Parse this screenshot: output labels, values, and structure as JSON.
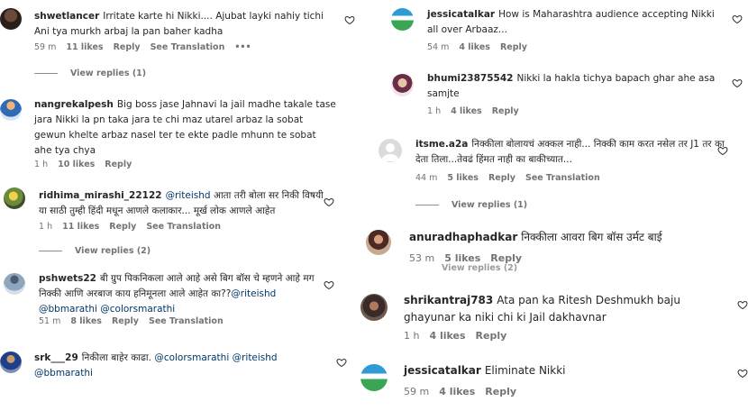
{
  "left": {
    "comments": [
      {
        "user": "shwetlancer",
        "text": "Irritate karte hi Nikki.... Ajubat layki nahiy tichi Ani tya murkh arbaj la pan baher kadha",
        "time": "59 m",
        "likes": "11 likes",
        "reply": "Reply",
        "extra": "See Translation",
        "more": "•••"
      },
      {
        "user": "nangrekalpesh",
        "text": "Big boss jase Jahnavi la jail madhe takale tase jara Nikki la pn taka jara te chi maz utarel arbaz la sobat gewun khelte arbaz nasel ter te ekte padle mhunn te sobat ahe tya chya",
        "time": "1 h",
        "likes": "10 likes",
        "reply": "Reply"
      },
      {
        "user": "ridhima_mirashi_22122",
        "mention": "@riteishd",
        "text": "आता तरी बोला सर निकी विषयी या साठी तुम्ही हिंदी मधून आणले कलाकार... मूर्ख लोक आणले आहेत",
        "time": "1 h",
        "likes": "11 likes",
        "reply": "Reply",
        "extra": "See Translation"
      },
      {
        "user": "pshwets22",
        "text": "बी ग्रुप पिकनिकला आले आहे असे बिग बॉस चे म्हणने आहे मग निक्की आणि अरबाज काय हनिमूनला आले आहेत का??",
        "mention": "@riteishd",
        "mention2": "@bbmarathi @colorsmarathi",
        "time": "51 m",
        "likes": "8 likes",
        "reply": "Reply",
        "extra": "See Translation"
      },
      {
        "user": "srk___29",
        "text": "निकीला बाहेर काढा.",
        "mention": "@colorsmarathi @riteishd",
        "mention2": "@bbmarathi"
      }
    ],
    "view_replies_1": "View replies (1)",
    "view_replies_2": "View replies (2)"
  },
  "right": {
    "comments": [
      {
        "user": "jessicatalkar",
        "text": "How is Maharashtra audience accepting Nikki all over Arbaaz...",
        "time": "54 m",
        "likes": "4 likes",
        "reply": "Reply"
      },
      {
        "user": "bhumi23875542",
        "text": "Nikki la hakla tichya bapach ghar ahe asa samjte",
        "time": "1 h",
        "likes": "4 likes",
        "reply": "Reply"
      },
      {
        "user": "itsme.a2a",
        "text": "निक्कीला बोलायचं अक्कल नाही... निक्की काम करत नसेल तर J1 तर का देता तिला...तेवढं हिंमत नाही का बाकीच्यात...",
        "time": "44 m",
        "likes": "5 likes",
        "reply": "Reply",
        "extra": "See Translation"
      },
      {
        "user": "anuradhaphadkar",
        "text": "निक्कीला आवरा बिग बॉस उर्मट बाई",
        "time": "53 m",
        "likes": "5 likes",
        "reply": "Reply"
      },
      {
        "user": "shrikantraj783",
        "text": "Ata pan ka Ritesh Deshmukh baju ghayunar ka niki chi ki Jail dakhavnar",
        "time": "1 h",
        "likes": "4 likes",
        "reply": "Reply"
      },
      {
        "user": "jessicatalkar",
        "text": "Eliminate Nikki",
        "time": "59 m",
        "likes": "4 likes",
        "reply": "Reply"
      }
    ],
    "view_replies_1": "View replies (1)",
    "view_replies_partial": "View replies (2)"
  },
  "colors": {
    "text": "#262626",
    "meta": "#737373",
    "mention": "#00376b",
    "background": "#ffffff"
  }
}
